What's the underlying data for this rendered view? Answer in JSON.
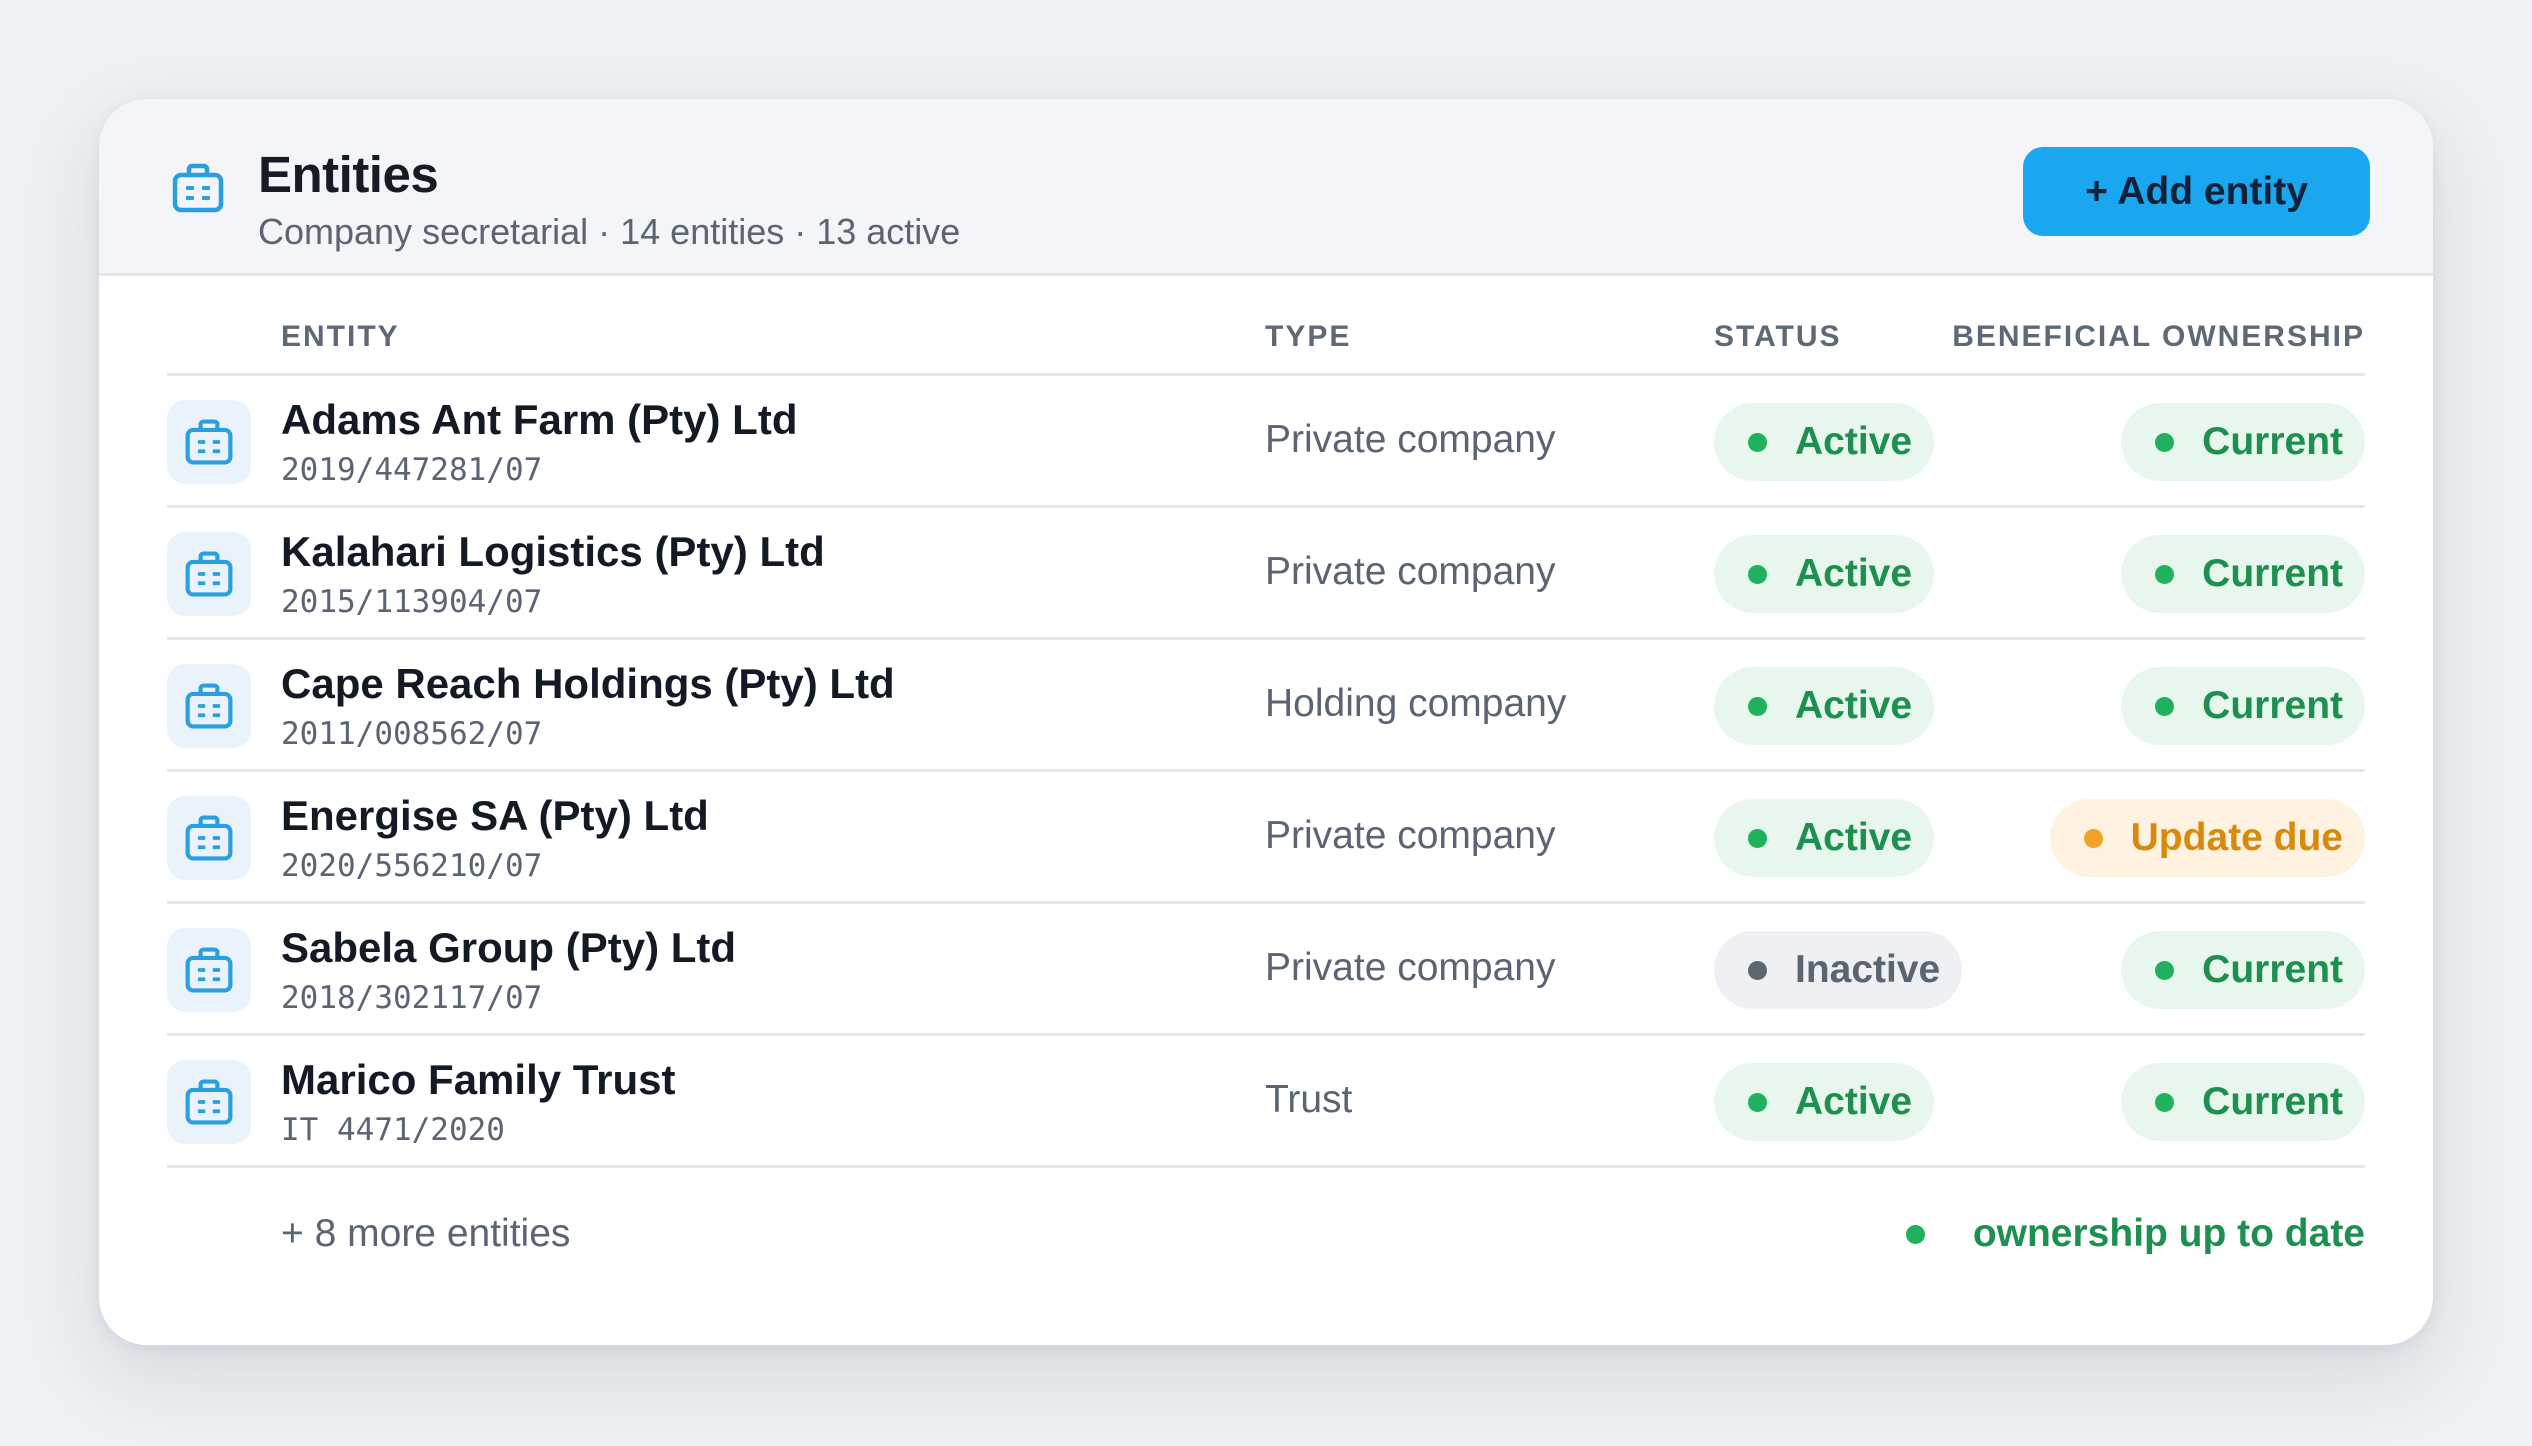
{
  "header": {
    "title": "Entities",
    "subtitle": "Company secretarial · 14 entities · 13 active",
    "add_button": "+ Add entity",
    "icon": "briefcase-icon"
  },
  "table": {
    "columns": [
      "ENTITY",
      "TYPE",
      "STATUS",
      "BENEFICIAL OWNERSHIP"
    ],
    "rows": [
      {
        "name": "Adams Ant Farm (Pty) Ltd",
        "reg": "2019/447281/07",
        "type": "Private company",
        "status": "Active",
        "status_tone": "green",
        "ownership": "Current",
        "ownership_tone": "green"
      },
      {
        "name": "Kalahari Logistics (Pty) Ltd",
        "reg": "2015/113904/07",
        "type": "Private company",
        "status": "Active",
        "status_tone": "green",
        "ownership": "Current",
        "ownership_tone": "green"
      },
      {
        "name": "Cape Reach Holdings (Pty) Ltd",
        "reg": "2011/008562/07",
        "type": "Holding company",
        "status": "Active",
        "status_tone": "green",
        "ownership": "Current",
        "ownership_tone": "green"
      },
      {
        "name": "Energise SA (Pty) Ltd",
        "reg": "2020/556210/07",
        "type": "Private company",
        "status": "Active",
        "status_tone": "green",
        "ownership": "Update due",
        "ownership_tone": "amber"
      },
      {
        "name": "Sabela Group (Pty) Ltd",
        "reg": "2018/302117/07",
        "type": "Private company",
        "status": "Inactive",
        "status_tone": "grey",
        "ownership": "Current",
        "ownership_tone": "green"
      },
      {
        "name": "Marico Family Trust",
        "reg": "IT 4471/2020",
        "type": "Trust",
        "status": "Active",
        "status_tone": "green",
        "ownership": "Current",
        "ownership_tone": "green"
      }
    ]
  },
  "footer": {
    "more": "+ 8 more entities",
    "legend": "ownership up to date"
  },
  "colors": {
    "accent": "#1aa7f0",
    "icon_blue": "#2a9fe0",
    "green": "#1d8f4e",
    "amber": "#d88a0c",
    "grey": "#5b6472"
  }
}
